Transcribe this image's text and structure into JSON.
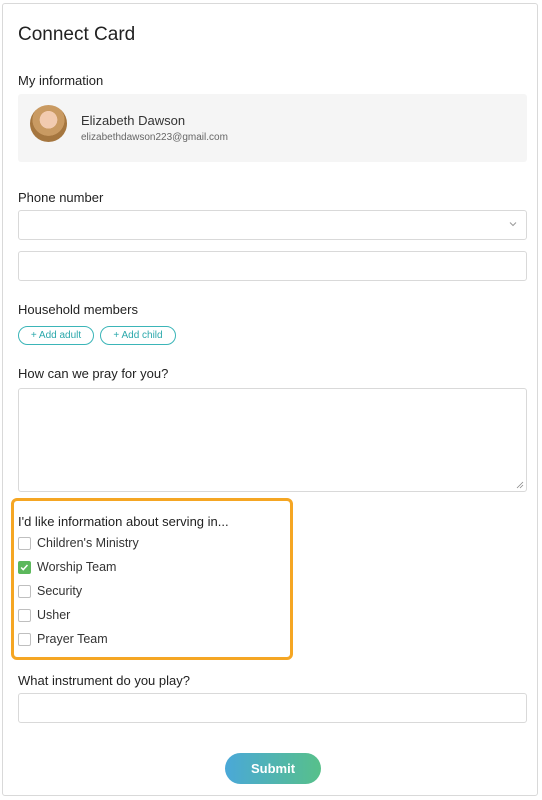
{
  "page": {
    "title": "Connect Card"
  },
  "my_information": {
    "heading": "My information",
    "name": "Elizabeth Dawson",
    "email": "elizabethdawson223@gmail.com"
  },
  "phone": {
    "heading": "Phone number",
    "country_value": "",
    "number_value": ""
  },
  "household": {
    "heading": "Household members",
    "add_adult": "+ Add adult",
    "add_child": "+ Add child"
  },
  "prayer": {
    "heading": "How can we pray for you?",
    "value": ""
  },
  "serving": {
    "heading": "I'd like information about serving in...",
    "options": [
      {
        "label": "Children's Ministry",
        "checked": false
      },
      {
        "label": "Worship Team",
        "checked": true
      },
      {
        "label": "Security",
        "checked": false
      },
      {
        "label": "Usher",
        "checked": false
      },
      {
        "label": "Prayer Team",
        "checked": false
      }
    ]
  },
  "instrument": {
    "heading": "What instrument do you play?",
    "value": ""
  },
  "submit_label": "Submit",
  "colors": {
    "accent_teal": "#2aa8ab",
    "check_green": "#5cb85c",
    "highlight_orange": "#f5a623",
    "submit_gradient_start": "#4aa8d8",
    "submit_gradient_end": "#57c08a"
  }
}
